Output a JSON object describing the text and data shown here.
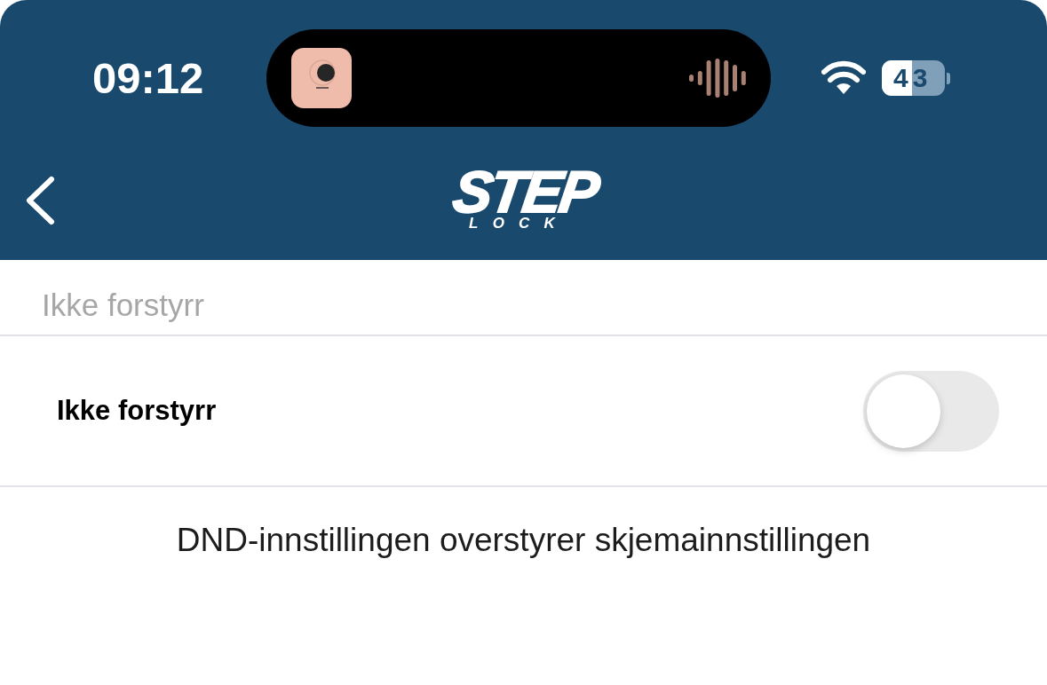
{
  "status_bar": {
    "time": "09:12",
    "battery": "43"
  },
  "nav_bar": {
    "logo": {
      "word": "STEP",
      "subword": "LOCK"
    }
  },
  "section": {
    "title": "Ikke forstyrr"
  },
  "settings": [
    {
      "kind": "toggle",
      "label": "Ikke forstyrr",
      "on": false
    }
  ],
  "footnote": "DND-innstillingen overstyrer skjemainnstillingen"
}
